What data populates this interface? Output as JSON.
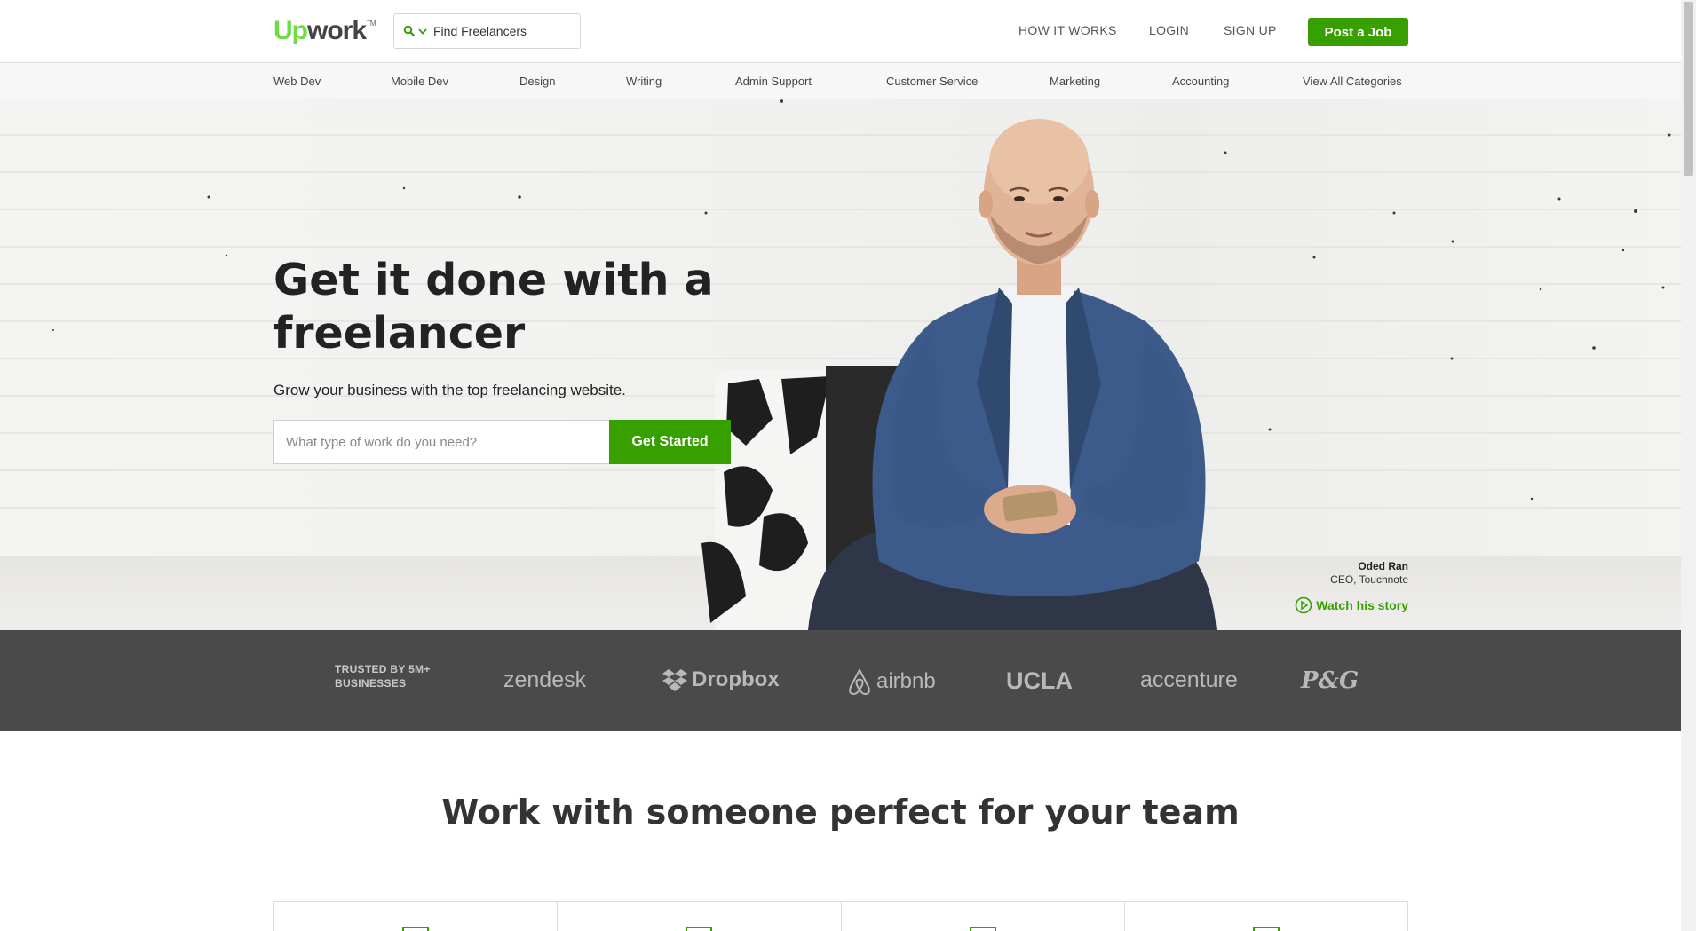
{
  "header": {
    "logo": {
      "up": "Up",
      "work": "work",
      "tm": "TM"
    },
    "search": {
      "label": "Find Freelancers"
    },
    "links": {
      "how_it_works": "HOW IT WORKS",
      "login": "LOGIN",
      "sign_up": "SIGN UP"
    },
    "post_job": "Post a Job"
  },
  "categories": [
    "Web Dev",
    "Mobile Dev",
    "Design",
    "Writing",
    "Admin Support",
    "Customer Service",
    "Marketing",
    "Accounting",
    "View All Categories"
  ],
  "hero": {
    "headline": "Get it done with a freelancer",
    "subhead": "Grow your business with the top freelancing website.",
    "input_placeholder": "What type of work do you need?",
    "cta": "Get Started",
    "caption_name": "Oded Ran",
    "caption_title": "CEO, Touchnote",
    "watch_story": "Watch his story"
  },
  "trusted": {
    "label_line1": "TRUSTED BY 5M+",
    "label_line2": "BUSINESSES",
    "brands": [
      "zendesk",
      "Dropbox",
      "airbnb",
      "UCLA",
      "accenture",
      "P&G"
    ]
  },
  "section": {
    "title": "Work with someone perfect for your team"
  },
  "colors": {
    "accent": "#37a000",
    "logo_green": "#6fda44",
    "band": "#4a4a4a"
  }
}
